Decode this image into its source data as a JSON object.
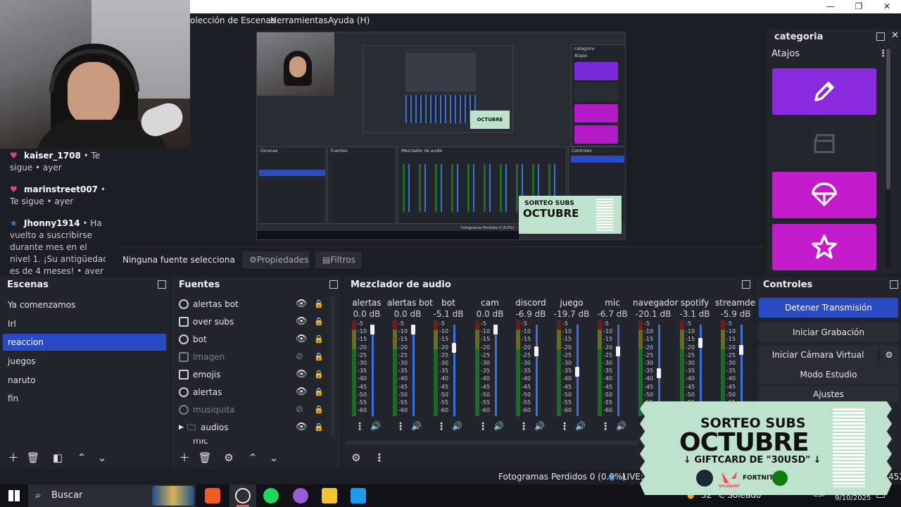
{
  "menu": {
    "scenes": "olección de Escenas",
    "tools": "Herramientas",
    "help": "Ayuda (H)"
  },
  "window_controls": {
    "minimize": "—",
    "maximize": "❐",
    "close": "✕"
  },
  "chat": [
    {
      "user": "kaiser_1708",
      "text": " • Te sigue • ayer",
      "icon": "heart-icon",
      "color": "#e0409a"
    },
    {
      "user": "marinstreet007",
      "text": " • Te sigue • ayer",
      "icon": "heart-icon",
      "color": "#e0409a"
    },
    {
      "user": "Jhonny1914",
      "text": " • Ha vuelto a suscribirse durante mes en el nivel 1. ¡Su antigüedad es de 4 meses! • ayer",
      "icon": "star-icon",
      "color": "#3a78e8"
    }
  ],
  "source_status": {
    "text": "Ninguna fuente selecciona",
    "properties": "Propiedades",
    "filters": "Filtros"
  },
  "categoria": {
    "title": "categoria",
    "subtitle": "Atajos",
    "buttons": [
      {
        "icon": "pencil-icon",
        "color": "#8a2be2"
      },
      {
        "icon": "clapper-icon",
        "color": "#24272f"
      },
      {
        "icon": "parachute-icon",
        "color": "#c41ccc"
      },
      {
        "icon": "star-icon",
        "color": "#c41ccc"
      }
    ]
  },
  "scenes": {
    "title": "Escenas",
    "items": [
      "Ya comenzamos",
      "Irl",
      "reaccion",
      "juegos",
      "naruto",
      "fin"
    ],
    "active": "reaccion"
  },
  "sources": {
    "title": "Fuentes",
    "items": [
      "alertas bot",
      "over subs",
      "bot",
      "Imagen",
      "emojis",
      "alertas",
      "musiquita",
      "audios",
      "mic"
    ]
  },
  "mixer": {
    "title": "Mezclador de audio",
    "channels": [
      {
        "name": "alertas",
        "db": "0.0 dB",
        "level": 1.0
      },
      {
        "name": "alertas bot",
        "db": "0.0 dB",
        "level": 1.0
      },
      {
        "name": "bot",
        "db": "-5.1 dB",
        "level": 0.78
      },
      {
        "name": "cam",
        "db": "0.0 dB",
        "level": 1.0
      },
      {
        "name": "discord",
        "db": "-6.9 dB",
        "level": 0.74
      },
      {
        "name": "juego",
        "db": "-19.7 dB",
        "level": 0.5
      },
      {
        "name": "mic",
        "db": "-6.7 dB",
        "level": 0.74
      },
      {
        "name": "navegador",
        "db": "-20.1 dB",
        "level": 0.48
      },
      {
        "name": "spotify",
        "db": "-3.1 dB",
        "level": 0.84
      },
      {
        "name": "streamdeck",
        "db": "-5.9 dB",
        "level": 0.76
      }
    ],
    "ticks": [
      "-5",
      "-10",
      "-15",
      "-20",
      "-25",
      "-30",
      "-35",
      "-40",
      "-45",
      "-50",
      "-55",
      "-60"
    ]
  },
  "controls": {
    "title": "Controles",
    "stop_stream": "Detener Transmisión",
    "start_rec": "Iniciar Grabación",
    "virtual_cam": "Iniciar Cámara Virtual",
    "studio": "Modo Estudio",
    "settings": "Ajustes"
  },
  "status": {
    "frames": "Fotogramas Perdidos 0 (0.0%)",
    "live": "LIVE:",
    "right": "452"
  },
  "taskbar": {
    "search": "Buscar",
    "weather": "32 °C  Soleado",
    "lang": "ESP",
    "date": "9/10/2025"
  },
  "sorteo": {
    "line1": "SORTEO SUBS",
    "line2": "OCTUBRE",
    "line3": "↓ GIFTCARD DE \"30USD\" ↓",
    "brand1": "VALORANT",
    "brand2": "FORTNITE"
  },
  "preview": {
    "category": "categoria",
    "atajos": "Atajos",
    "escenas": "Escenas",
    "fuentes": "Fuentes",
    "mezclador": "Mezclador de audio",
    "controles": "Controles",
    "frames": "Fotogramas Perdidos 0 (0.0%)",
    "octubre": "OCTUBRE",
    "sorteo": "SORTEO SUBS"
  }
}
